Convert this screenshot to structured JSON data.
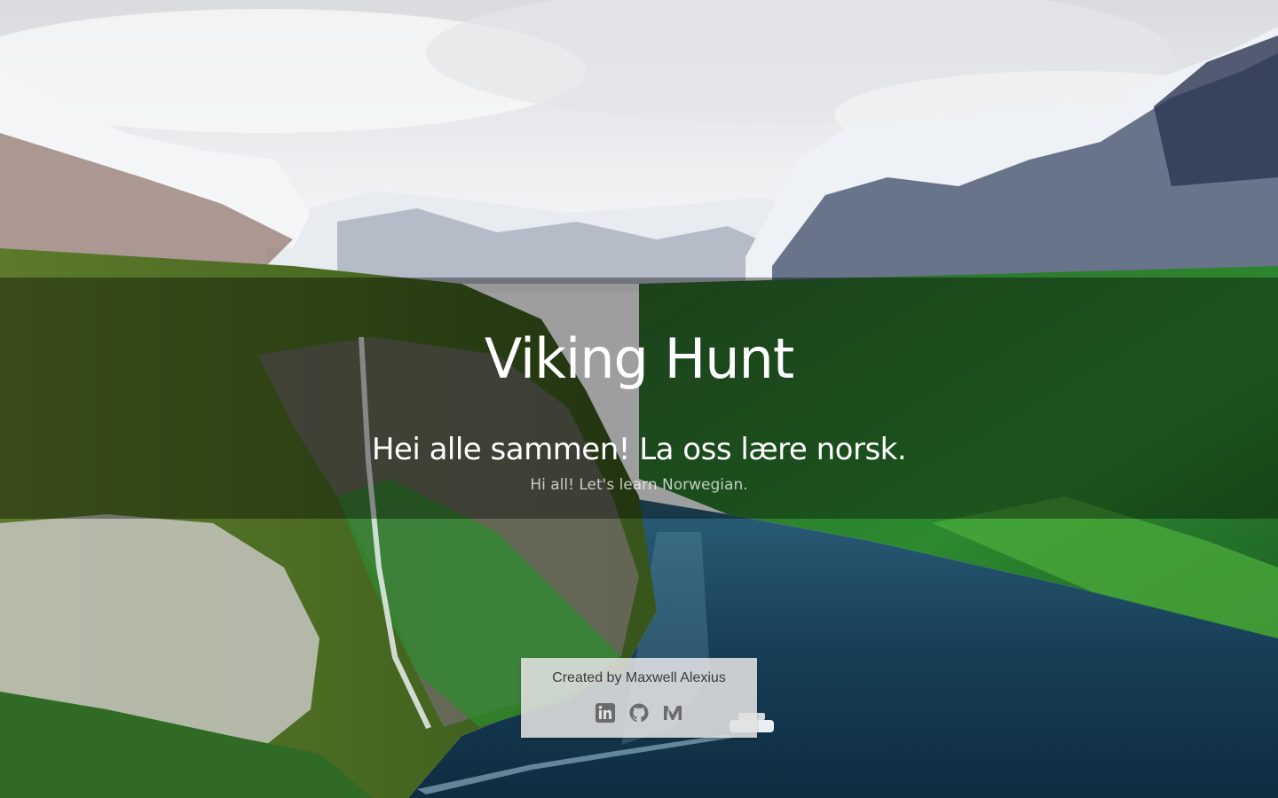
{
  "hero": {
    "title": "Viking Hunt",
    "subtitle": "Hei alle sammen! La oss lære norsk.",
    "translation": "Hi all! Let's learn Norwegian."
  },
  "footer": {
    "credit": "Created by Maxwell Alexius",
    "links": [
      {
        "icon": "linkedin-icon"
      },
      {
        "icon": "github-icon"
      },
      {
        "icon": "medium-icon"
      }
    ]
  },
  "colors": {
    "overlay": "#000000",
    "text": "#ffffff",
    "card": "#e1e1e1",
    "credit_text": "#3a3a3a",
    "icon": "#6b6b6b"
  }
}
